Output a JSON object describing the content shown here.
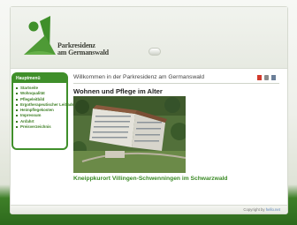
{
  "logo": {
    "line1": "Parkresidenz",
    "line2": "am Germanswald"
  },
  "sidebar": {
    "title": "Hauptmenü",
    "items": [
      {
        "label": "Startseite"
      },
      {
        "label": "Wohnqualität"
      },
      {
        "label": "Pflegeleitbild"
      },
      {
        "label": "Ergotherapeutischer Leitfaden"
      },
      {
        "label": "Heimpflegekosten"
      },
      {
        "label": "Impressum"
      },
      {
        "label": "Anfahrt"
      },
      {
        "label": "Preisverzeichnis"
      }
    ]
  },
  "main": {
    "welcome": "Willkommen in der Parkresidenz am Germanswald",
    "heading": "Wohnen und Pflege im Alter",
    "caption": "Kneippkurort Villingen-Schwenningen im Schwarzwald"
  },
  "toolbar": {
    "icons": [
      "pdf-icon",
      "print-icon",
      "email-icon"
    ]
  },
  "footer": {
    "prefix": "Copyright by",
    "link": "hello.net"
  },
  "colors": {
    "accent_green": "#3f8f2a",
    "link_green": "#3b7d22",
    "footer_link": "#5d84b9"
  }
}
